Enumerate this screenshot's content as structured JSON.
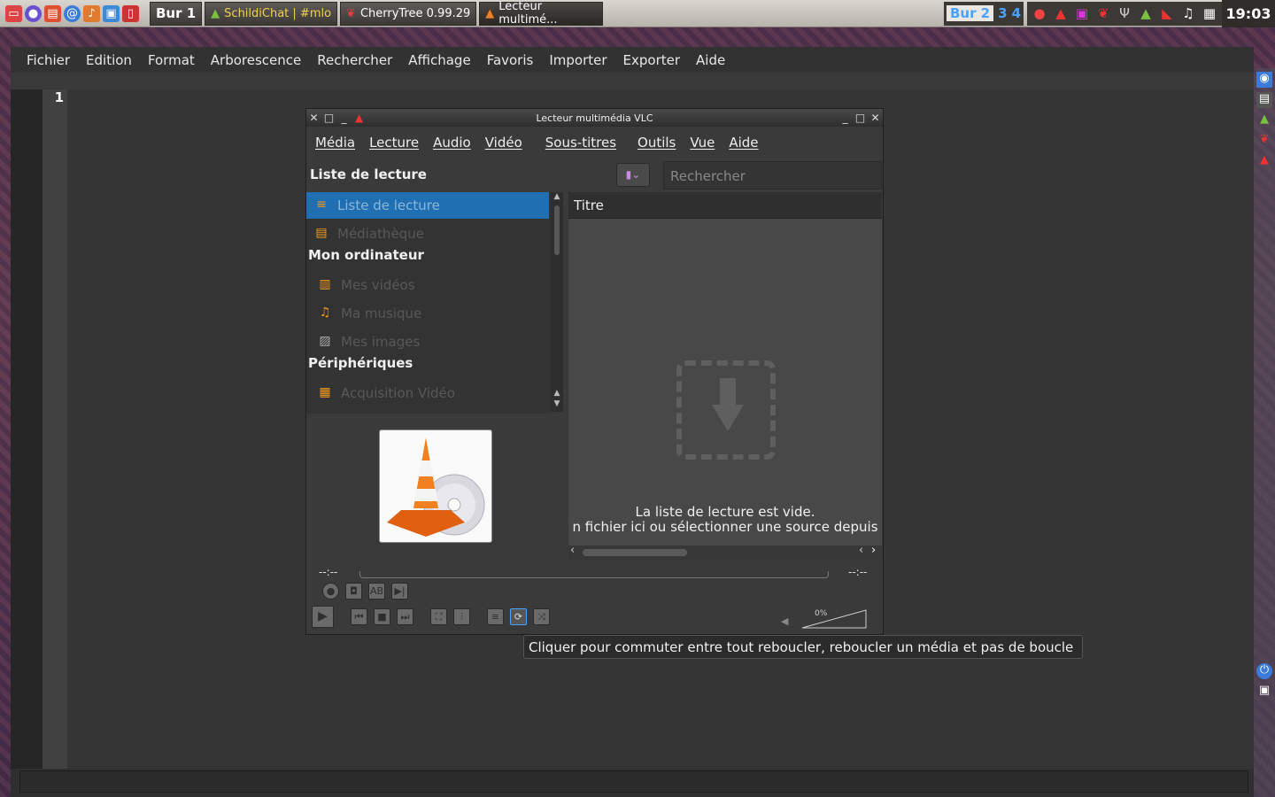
{
  "taskbar": {
    "desktop_label": "Bur 1",
    "tasks": [
      {
        "label": "SchildiChat | #mlo",
        "icon": "schildichat-icon"
      },
      {
        "label": "CherryTree 0.99.29",
        "icon": "cherrytree-icon"
      },
      {
        "label": "Lecteur multimé...",
        "icon": "vlc-icon"
      }
    ],
    "workspaces": [
      "Bur 2",
      "3",
      "4"
    ],
    "clock": "19:03"
  },
  "cherrytree": {
    "menu": [
      "Fichier",
      "Edition",
      "Format",
      "Arborescence",
      "Rechercher",
      "Affichage",
      "Favoris",
      "Importer",
      "Exporter",
      "Aide"
    ],
    "line_number": "1"
  },
  "vlc": {
    "title": "Lecteur multimédia VLC",
    "menu": [
      "Média",
      "Lecture",
      "Audio",
      "Vidéo",
      "Sous-titres",
      "Outils",
      "Vue",
      "Aide"
    ],
    "playlist_title": "Liste de lecture",
    "search_placeholder": "Rechercher",
    "sidebar": {
      "playlist": "Liste de lecture",
      "library": "Médiathèque",
      "my_computer": "Mon ordinateur",
      "videos": "Mes vidéos",
      "music": "Ma musique",
      "images": "Mes images",
      "devices": "Périphériques",
      "capture": "Acquisition Vidéo"
    },
    "column_title": "Titre",
    "empty_line1": "La liste de lecture est vide.",
    "empty_line2": "n fichier ici ou sélectionner une source depuis",
    "time_elapsed": "--:--",
    "time_total": "--:--",
    "volume": "0%"
  },
  "tooltip": "Cliquer pour commuter entre tout reboucler, reboucler un média et pas de boucle"
}
